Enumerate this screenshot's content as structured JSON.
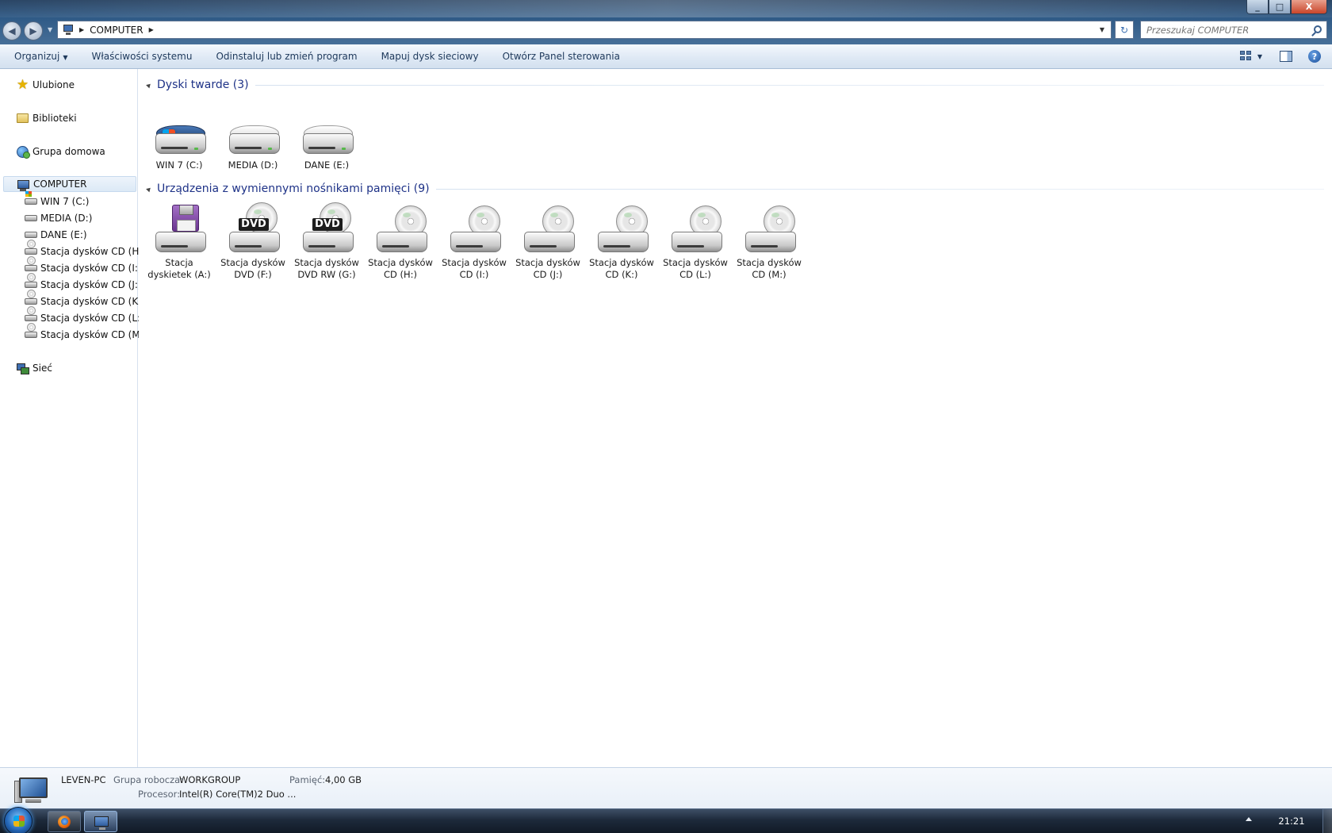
{
  "window": {
    "minimize_glyph": "_",
    "maximize_glyph": "□",
    "close_glyph": "X"
  },
  "nav_buttons": {
    "back_glyph": "◀",
    "forward_glyph": "▶",
    "history_glyph": "▼"
  },
  "address": {
    "breadcrumbs": [
      "COMPUTER"
    ],
    "separator_glyph": "▶",
    "refresh_glyph": "↻"
  },
  "search": {
    "placeholder": "Przeszukaj COMPUTER"
  },
  "toolbar": {
    "organize": "Organizuj",
    "system_properties": "Właściwości systemu",
    "uninstall": "Odinstaluj lub zmień program",
    "map_drive": "Mapuj dysk sieciowy",
    "control_panel": "Otwórz Panel sterowania",
    "help_glyph": "?"
  },
  "navpane": {
    "favorites": "Ulubione",
    "libraries": "Biblioteki",
    "homegroup": "Grupa domowa",
    "computer": "COMPUTER",
    "drives": [
      {
        "label": "WIN 7 (C:)",
        "kind": "windows-drive-icon"
      },
      {
        "label": "MEDIA (D:)",
        "kind": "hard-drive-icon"
      },
      {
        "label": "DANE (E:)",
        "kind": "hard-drive-icon"
      },
      {
        "label": "Stacja dysków CD (H:)",
        "kind": "cd-drive-icon"
      },
      {
        "label": "Stacja dysków CD (I:)",
        "kind": "cd-drive-icon"
      },
      {
        "label": "Stacja dysków CD (J:)",
        "kind": "cd-drive-icon"
      },
      {
        "label": "Stacja dysków CD (K:)",
        "kind": "cd-drive-icon"
      },
      {
        "label": "Stacja dysków CD (L:)",
        "kind": "cd-drive-icon"
      },
      {
        "label": "Stacja dysków CD (M:)",
        "kind": "cd-drive-icon"
      }
    ],
    "network": "Sieć"
  },
  "content": {
    "hard_drives_header": "Dyski twarde (3)",
    "hard_drives": [
      {
        "line1": "WIN 7 (C:)",
        "line2": "",
        "kind": "windows-drive-icon"
      },
      {
        "line1": "MEDIA (D:)",
        "line2": "",
        "kind": "hard-drive-icon"
      },
      {
        "line1": "DANE (E:)",
        "line2": "",
        "kind": "hard-drive-icon"
      }
    ],
    "removable_header": "Urządzenia z wymiennymi nośnikami pamięci (9)",
    "removable": [
      {
        "line1": "Stacja",
        "line2": "dyskietek (A:)",
        "kind": "floppy-drive-icon"
      },
      {
        "line1": "Stacja dysków",
        "line2": "DVD (F:)",
        "kind": "dvd-drive-icon"
      },
      {
        "line1": "Stacja dysków",
        "line2": "DVD RW (G:)",
        "kind": "dvd-drive-icon"
      },
      {
        "line1": "Stacja dysków",
        "line2": "CD (H:)",
        "kind": "cd-drive-icon"
      },
      {
        "line1": "Stacja dysków",
        "line2": "CD (I:)",
        "kind": "cd-drive-icon"
      },
      {
        "line1": "Stacja dysków",
        "line2": "CD (J:)",
        "kind": "cd-drive-icon"
      },
      {
        "line1": "Stacja dysków",
        "line2": "CD (K:)",
        "kind": "cd-drive-icon"
      },
      {
        "line1": "Stacja dysków",
        "line2": "CD (L:)",
        "kind": "cd-drive-icon"
      },
      {
        "line1": "Stacja dysków",
        "line2": "CD (M:)",
        "kind": "cd-drive-icon"
      }
    ],
    "dvd_badge": "DVD"
  },
  "details": {
    "computer_name": "LEVEN-PC",
    "workgroup_label": "Grupa robocza:",
    "workgroup_value": "WORKGROUP",
    "memory_label": "Pamięć:",
    "memory_value": "4,00 GB",
    "processor_label": "Procesor:",
    "processor_value": "Intel(R) Core(TM)2 Duo ..."
  },
  "taskbar": {
    "clock": "21:21"
  },
  "colors": {
    "accent": "#1e3287",
    "toolbar_text": "#1e395b",
    "window_chrome": "#2f5a86"
  }
}
